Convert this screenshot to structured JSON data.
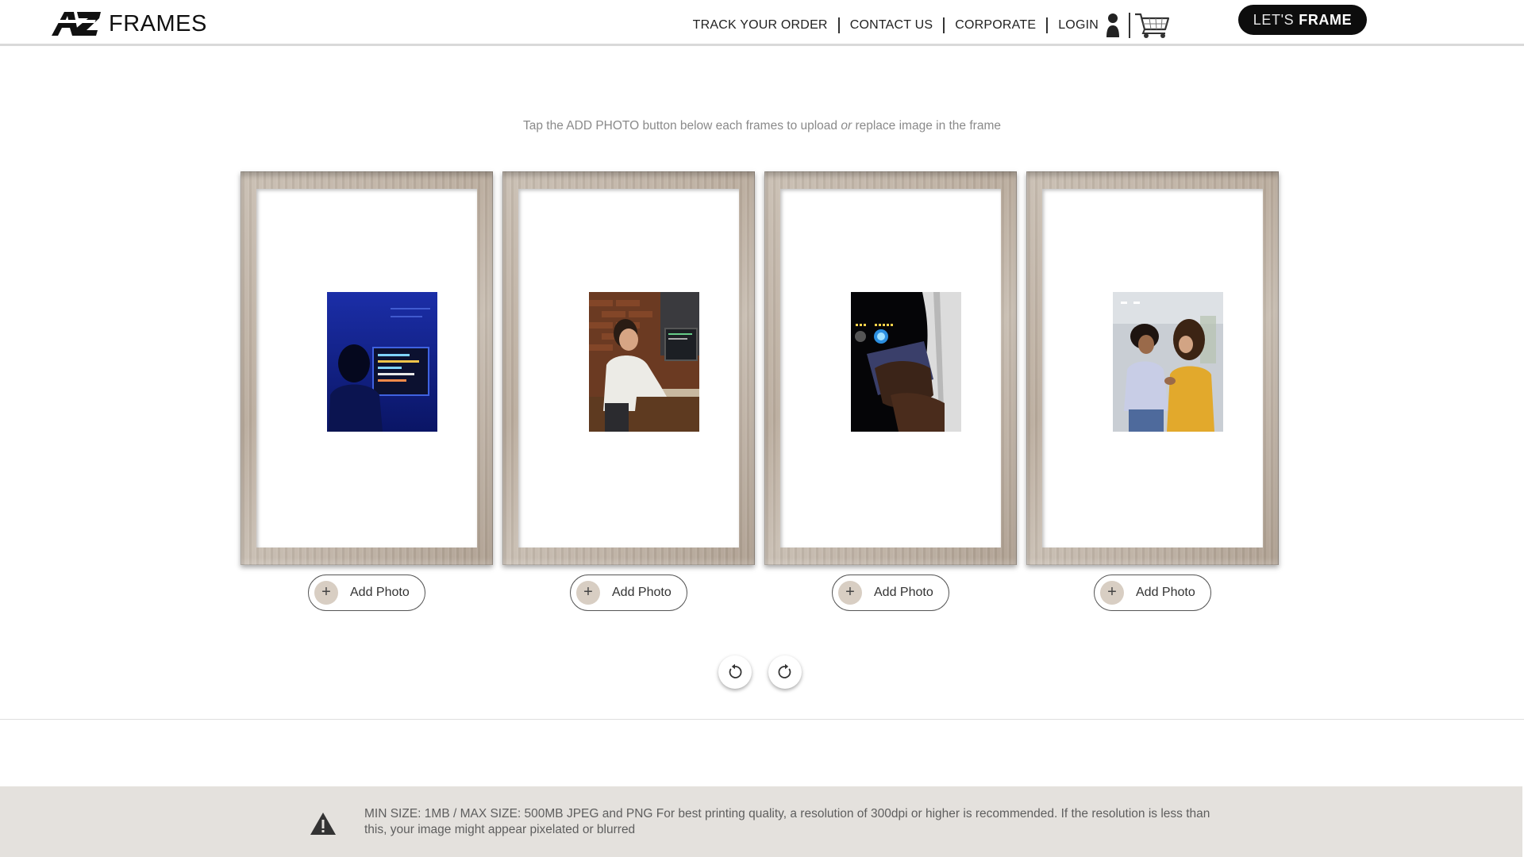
{
  "header": {
    "logo_text": "FRAMES",
    "nav": [
      {
        "label": "TRACK YOUR ORDER"
      },
      {
        "label": "CONTACT US"
      },
      {
        "label": "CORPORATE"
      },
      {
        "label": "LOGIN"
      }
    ],
    "cta_light": "LET'S",
    "cta_bold": "FRAME"
  },
  "instruction": {
    "before": "Tap the ADD PHOTO button below each frames to upload ",
    "emphasis": "or",
    "after": " replace image in the frame"
  },
  "frames": [
    {
      "add_label": "Add Photo",
      "plus": "+"
    },
    {
      "add_label": "Add Photo",
      "plus": "+"
    },
    {
      "add_label": "Add Photo",
      "plus": "+"
    },
    {
      "add_label": "Add Photo",
      "plus": "+"
    }
  ],
  "icons": {
    "user": "user-icon",
    "cart": "cart-icon",
    "rotate_left": "rotate-left-icon",
    "rotate_right": "rotate-right-icon",
    "warning": "warning-icon"
  },
  "notice": {
    "text": "MIN SIZE: 1MB / MAX SIZE: 500MB JPEG and PNG For best printing quality, a resolution of 300dpi or higher is recommended. If the resolution is less than this, your image might appear pixelated or blurred"
  },
  "colors": {
    "cta_bg": "#0d0d0d",
    "frame_wood": "#bdb0a3",
    "plus_circle": "#d8cec3",
    "notice_bg": "#e4e1dd"
  }
}
